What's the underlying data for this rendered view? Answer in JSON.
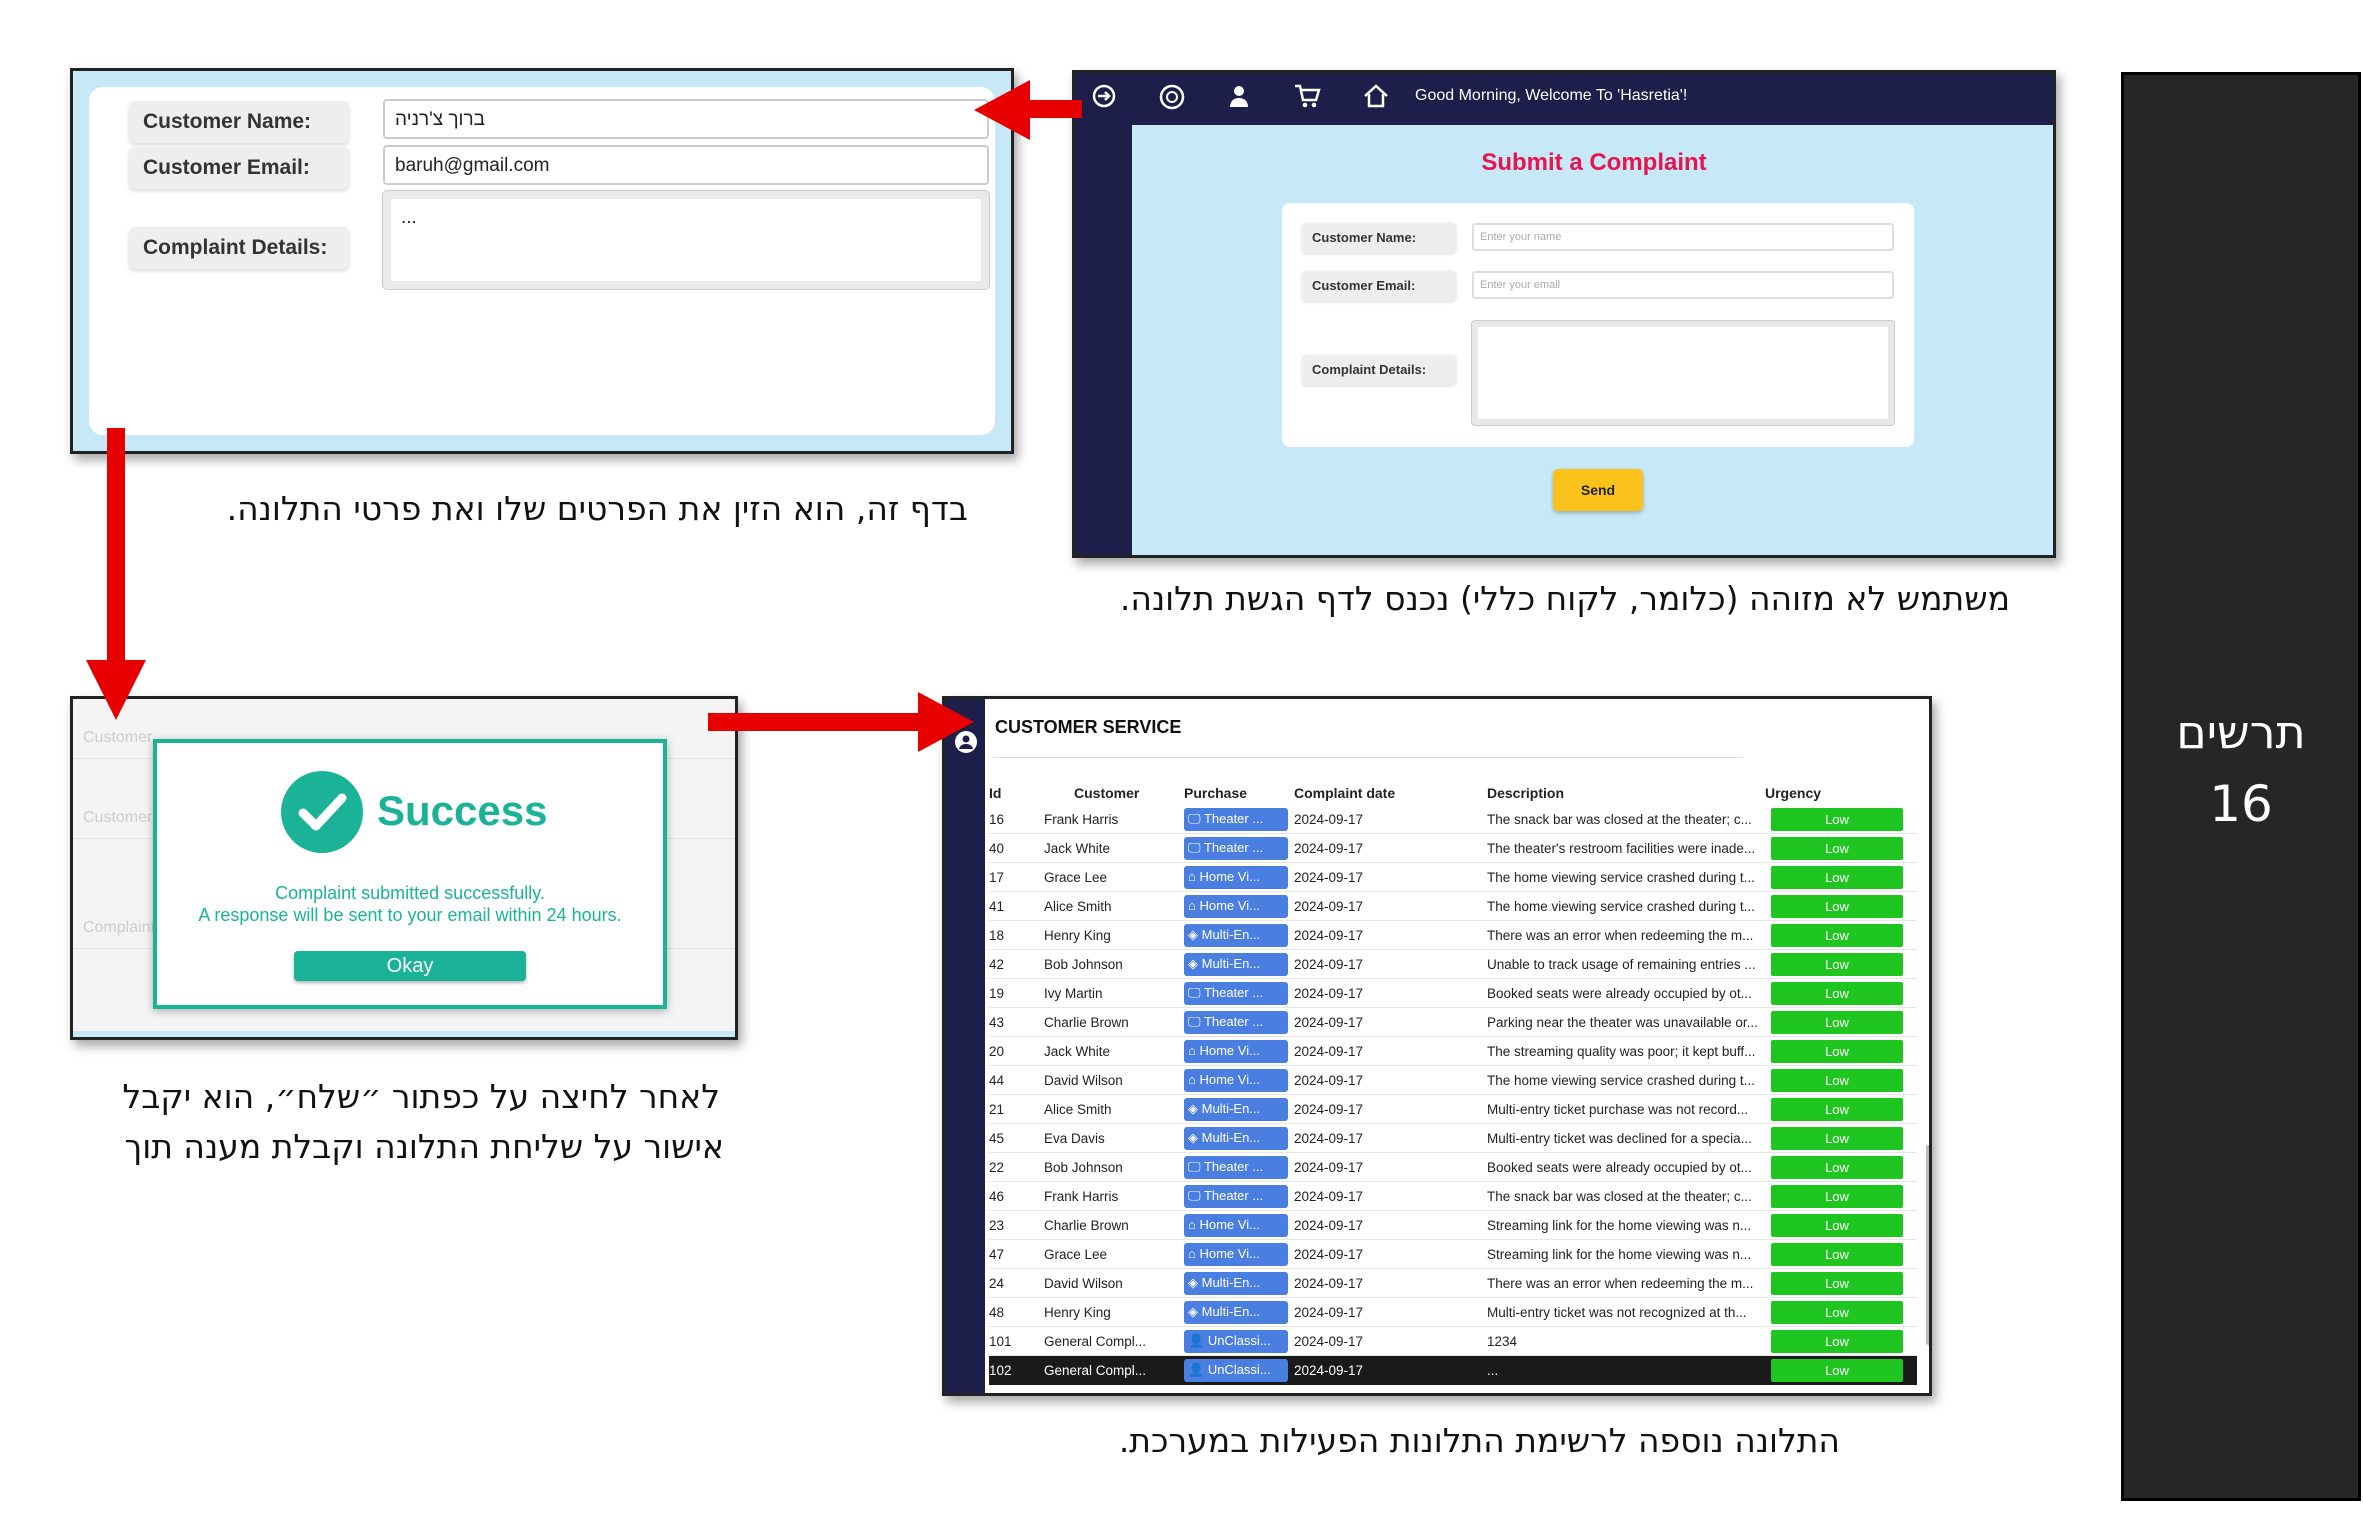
{
  "captions": {
    "panel1": "בדף זה, הוא הזין את הפרטים שלו ואת פרטי התלונה.",
    "panel2": "משתמש לא מזוהה (כלומר, לקוח כללי) נכנס לדף הגשת תלונה.",
    "panel3_line1": "לאחר לחיצה על כפתור ״שלח״, הוא יקבל",
    "panel3_line2": "אישור על שליחת התלונה וקבלת מענה תוך",
    "panel4": "התלונה נוספה לרשימת התלונות הפעילות במערכת."
  },
  "figure": {
    "label": "תרשים",
    "number": "16"
  },
  "filled_form": {
    "name_label": "Customer Name:",
    "name_value": "ברוך צ'רניה",
    "email_label": "Customer Email:",
    "email_value": "baruh@gmail.com",
    "details_label": "Complaint Details:",
    "details_value": "..."
  },
  "complaint_page": {
    "welcome": "Good Morning, Welcome To 'Hasretia'!",
    "title": "Submit a Complaint",
    "name_label": "Customer Name:",
    "name_placeholder": "Enter your name",
    "email_label": "Customer Email:",
    "email_placeholder": "Enter your email",
    "details_label": "Complaint Details:",
    "send": "Send",
    "icons": [
      "logout-icon",
      "logo-icon",
      "user-icon",
      "cart-icon",
      "home-icon"
    ]
  },
  "success_dialog": {
    "title": "Success",
    "line1": "Complaint submitted successfully.",
    "line2": "A response will be sent to your email within 24 hours.",
    "okay": "Okay",
    "ghost1": "Customer",
    "ghost2": "Customer",
    "ghost3": "Complaint"
  },
  "service_table": {
    "title": "CUSTOMER SERVICE",
    "headers": [
      "Id",
      "Customer",
      "Purchase",
      "Complaint date",
      "Description",
      "Urgency"
    ],
    "rows": [
      {
        "id": "16",
        "customer": "Frank Harris",
        "purchase": "Theater ...",
        "picon": "🖵",
        "date": "2024-09-17",
        "desc": "The snack bar was closed at the theater; c...",
        "urgency": "Low"
      },
      {
        "id": "40",
        "customer": "Jack White",
        "purchase": "Theater ...",
        "picon": "🖵",
        "date": "2024-09-17",
        "desc": "The theater's restroom facilities were inade...",
        "urgency": "Low"
      },
      {
        "id": "17",
        "customer": "Grace Lee",
        "purchase": "Home Vi...",
        "picon": "⌂",
        "date": "2024-09-17",
        "desc": "The home viewing service crashed during t...",
        "urgency": "Low"
      },
      {
        "id": "41",
        "customer": "Alice Smith",
        "purchase": "Home Vi...",
        "picon": "⌂",
        "date": "2024-09-17",
        "desc": "The home viewing service crashed during t...",
        "urgency": "Low"
      },
      {
        "id": "18",
        "customer": "Henry King",
        "purchase": "Multi-En...",
        "picon": "◈",
        "date": "2024-09-17",
        "desc": "There was an error when redeeming the m...",
        "urgency": "Low"
      },
      {
        "id": "42",
        "customer": "Bob Johnson",
        "purchase": "Multi-En...",
        "picon": "◈",
        "date": "2024-09-17",
        "desc": "Unable to track usage of remaining entries ...",
        "urgency": "Low"
      },
      {
        "id": "19",
        "customer": "Ivy Martin",
        "purchase": "Theater ...",
        "picon": "🖵",
        "date": "2024-09-17",
        "desc": "Booked seats were already occupied by ot...",
        "urgency": "Low"
      },
      {
        "id": "43",
        "customer": "Charlie Brown",
        "purchase": "Theater ...",
        "picon": "🖵",
        "date": "2024-09-17",
        "desc": "Parking near the theater was unavailable or...",
        "urgency": "Low"
      },
      {
        "id": "20",
        "customer": "Jack White",
        "purchase": "Home Vi...",
        "picon": "⌂",
        "date": "2024-09-17",
        "desc": "The streaming quality was poor; it kept buff...",
        "urgency": "Low"
      },
      {
        "id": "44",
        "customer": "David Wilson",
        "purchase": "Home Vi...",
        "picon": "⌂",
        "date": "2024-09-17",
        "desc": "The home viewing service crashed during t...",
        "urgency": "Low"
      },
      {
        "id": "21",
        "customer": "Alice Smith",
        "purchase": "Multi-En...",
        "picon": "◈",
        "date": "2024-09-17",
        "desc": "Multi-entry ticket purchase was not record...",
        "urgency": "Low"
      },
      {
        "id": "45",
        "customer": "Eva Davis",
        "purchase": "Multi-En...",
        "picon": "◈",
        "date": "2024-09-17",
        "desc": "Multi-entry ticket was declined for a specia...",
        "urgency": "Low"
      },
      {
        "id": "22",
        "customer": "Bob Johnson",
        "purchase": "Theater ...",
        "picon": "🖵",
        "date": "2024-09-17",
        "desc": "Booked seats were already occupied by ot...",
        "urgency": "Low"
      },
      {
        "id": "46",
        "customer": "Frank Harris",
        "purchase": "Theater ...",
        "picon": "🖵",
        "date": "2024-09-17",
        "desc": "The snack bar was closed at the theater; c...",
        "urgency": "Low"
      },
      {
        "id": "23",
        "customer": "Charlie Brown",
        "purchase": "Home Vi...",
        "picon": "⌂",
        "date": "2024-09-17",
        "desc": "Streaming link for the home viewing was n...",
        "urgency": "Low"
      },
      {
        "id": "47",
        "customer": "Grace Lee",
        "purchase": "Home Vi...",
        "picon": "⌂",
        "date": "2024-09-17",
        "desc": "Streaming link for the home viewing was n...",
        "urgency": "Low"
      },
      {
        "id": "24",
        "customer": "David Wilson",
        "purchase": "Multi-En...",
        "picon": "◈",
        "date": "2024-09-17",
        "desc": "There was an error when redeeming the m...",
        "urgency": "Low"
      },
      {
        "id": "48",
        "customer": "Henry King",
        "purchase": "Multi-En...",
        "picon": "◈",
        "date": "2024-09-17",
        "desc": "Multi-entry ticket was not recognized at th...",
        "urgency": "Low"
      },
      {
        "id": "101",
        "customer": "General Compl...",
        "purchase": "UnClassi...",
        "picon": "👤",
        "date": "2024-09-17",
        "desc": "1234",
        "urgency": "Low"
      },
      {
        "id": "102",
        "customer": "General Compl...",
        "purchase": "UnClassi...",
        "picon": "👤",
        "date": "2024-09-17",
        "desc": "...",
        "urgency": "Low"
      }
    ]
  },
  "colors": {
    "navy": "#1e1e4a",
    "light_blue": "#c6e8f7",
    "title_red": "#e8144f",
    "teal": "#1bb398",
    "badge_blue": "#4a7ee0",
    "urgency_green": "#1fc61f",
    "arrow_red": "#e60000",
    "send_yellow": "#fbc21c"
  }
}
